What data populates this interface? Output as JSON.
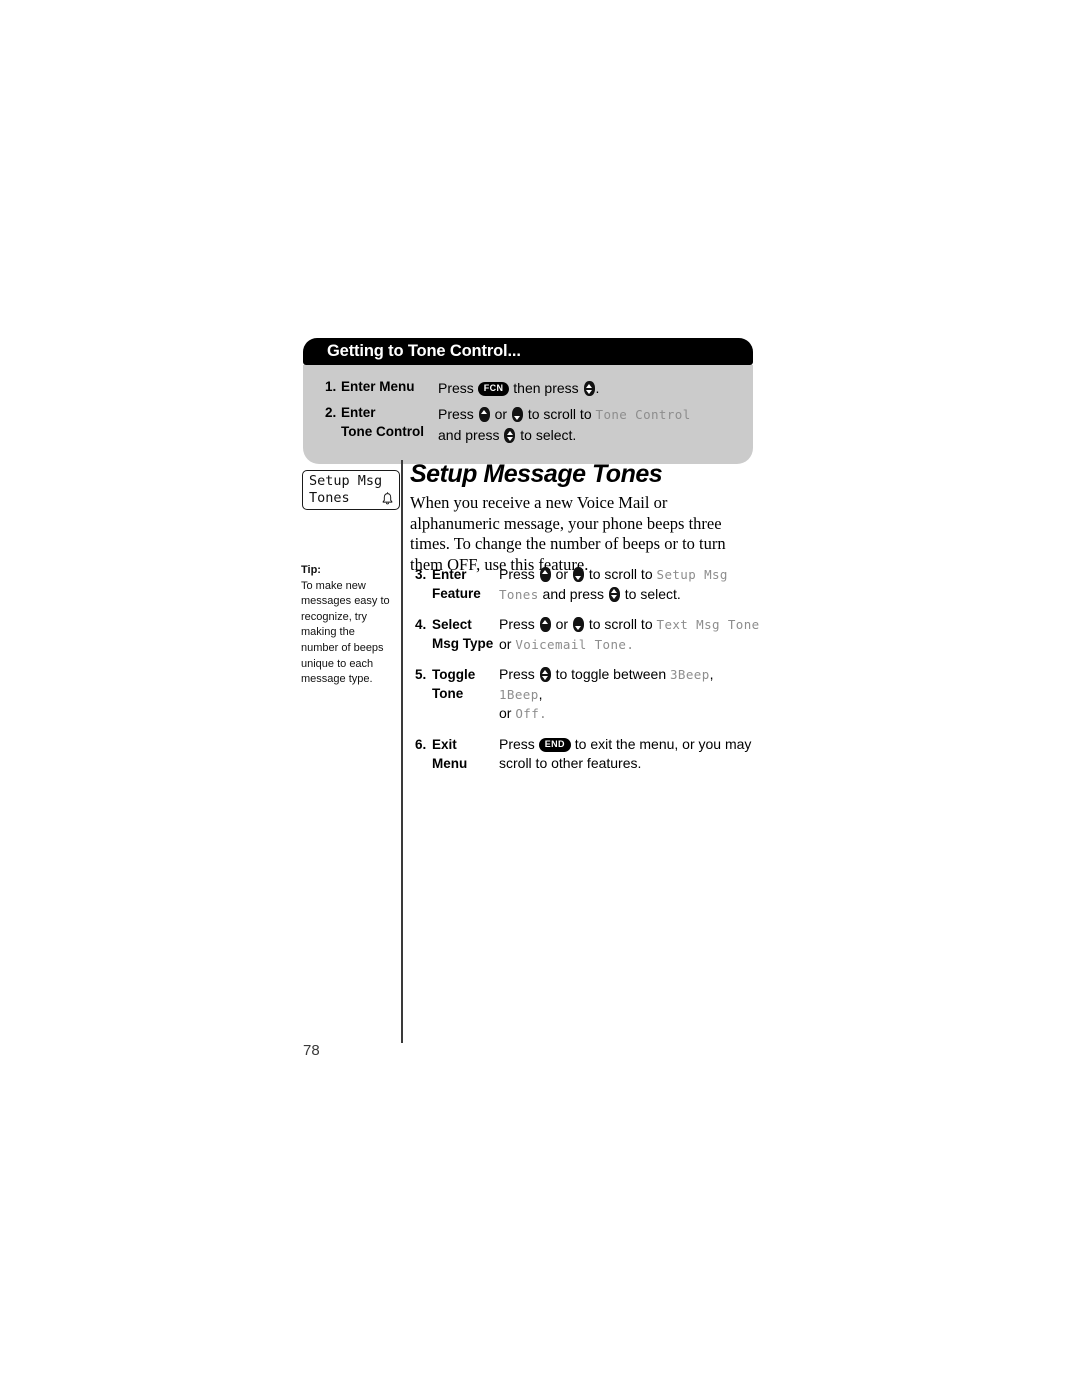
{
  "document": {
    "page_number": "78"
  },
  "callout": {
    "header_title": "Getting to Tone Control...",
    "steps": [
      {
        "num": "1.",
        "title_line1": "Enter Menu",
        "title_line2": "",
        "desc_line1_pre": "Press",
        "desc_line1_key": "FCN",
        "desc_line1_mid": "then press",
        "desc_line1_post": ".",
        "desc_line2": ""
      },
      {
        "num": "2.",
        "title_line1": "Enter",
        "title_line2": "Tone Control",
        "desc_line1_pre": "Press",
        "desc_line1_mid": "or",
        "desc_line1_post": "to scroll to",
        "desc_line1_lcd": "Tone Control",
        "desc_line2_pre": "and press",
        "desc_line2_post": "to select."
      }
    ]
  },
  "phone_display": {
    "line1": "Setup Msg",
    "line2": "Tones",
    "icon": "bell-icon"
  },
  "article": {
    "title": "Setup Message Tones",
    "body": "When you receive a new Voice Mail or alphanumeric message, your phone beeps three times. To change the number of beeps or to turn them OFF, use this feature."
  },
  "tip": {
    "label": "Tip:",
    "text": "To make new messages easy to recognize, try making the number of beeps unique to each message type."
  },
  "steps": [
    {
      "num": "3.",
      "title_line1": "Enter",
      "title_line2": "Feature",
      "l1_pre": "Press",
      "l1_mid": "or",
      "l1_post": "to scroll to",
      "l1_lcd": "Setup Msg",
      "l2_lcd": "Tones",
      "l2_mid": "and press",
      "l2_post": "to select."
    },
    {
      "num": "4.",
      "title_line1": "Select",
      "title_line2": "Msg Type",
      "l1_pre": "Press",
      "l1_mid": "or",
      "l1_post": "to scroll to",
      "l1_lcd": "Text Msg Tone",
      "l2_pre": "or",
      "l2_lcd": "Voicemail Tone",
      "l2_post": "."
    },
    {
      "num": "5.",
      "title_line1": "Toggle",
      "title_line2": "Tone",
      "l1_pre": "Press",
      "l1_post": "to toggle between",
      "l1_lcd": "3Beep",
      "l1_lcd2": "1Beep",
      "l1_comma": ",",
      "l2_pre": "or",
      "l2_lcd": "Off",
      "l2_post": "."
    },
    {
      "num": "6.",
      "title_line1": "Exit",
      "title_line2": "Menu",
      "l1_pre": "Press",
      "l1_key": "END",
      "l1_post": "to exit the menu, or you may",
      "l2_text": "scroll to other features."
    }
  ],
  "keys": {
    "fcn": "FCN",
    "end": "END",
    "scroll_up": "scroll-up-key",
    "scroll_down": "scroll-down-key",
    "select": "select-key"
  }
}
